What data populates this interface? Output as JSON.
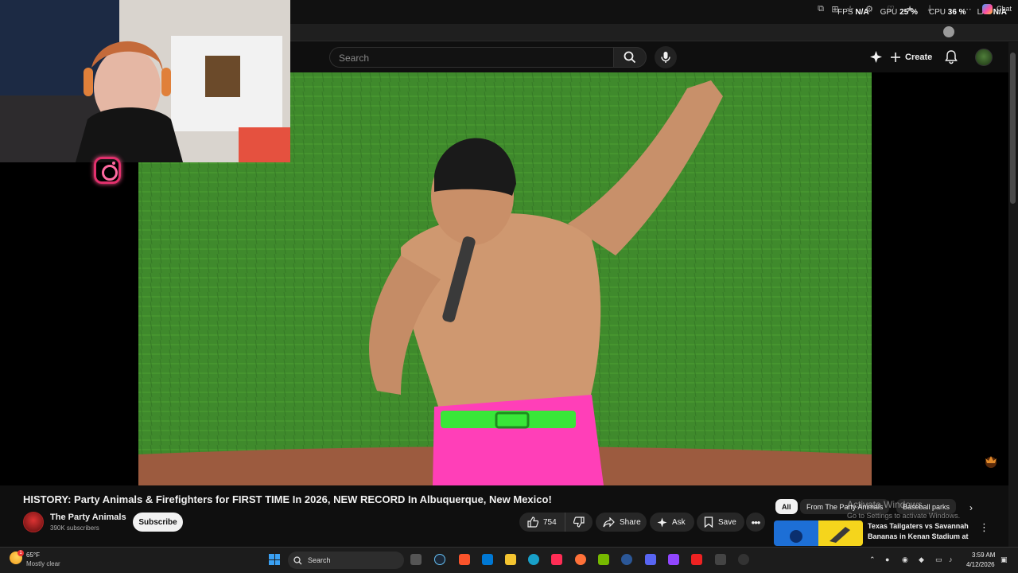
{
  "perf": {
    "fps_label": "FPS",
    "fps_value": "N/A",
    "gpu_label": "GPU",
    "gpu_value": "25 %",
    "cpu_label": "CPU",
    "cpu_value": "36 %",
    "lat_label": "LAT",
    "lat_value": "N/A"
  },
  "browser": {
    "chat_label": "Chat"
  },
  "masthead": {
    "search_placeholder": "Search",
    "create_label": "Create"
  },
  "video": {
    "title": "HISTORY: Party Animals & Firefighters for FIRST TIME In 2026, NEW RECORD In Albuquerque, New Mexico!",
    "channel_name": "The Party Animals",
    "subscribers": "390K subscribers",
    "subscribe_label": "Subscribe",
    "like_count": "754",
    "share_label": "Share",
    "ask_label": "Ask",
    "save_label": "Save"
  },
  "chips": [
    "All",
    "From The Party Animals",
    "Baseball parks"
  ],
  "recommendation": {
    "title": "Texas Tailgaters vs Savannah Bananas in Kenan Stadium at ..."
  },
  "watermark": {
    "line1": "Activate Windows",
    "line2": "Go to Settings to activate Windows."
  },
  "taskbar": {
    "temperature": "65°F",
    "condition": "Mostly clear",
    "weather_badge": "1",
    "search_label": "Search",
    "time": "3:59 AM",
    "date": "4/12/2026"
  },
  "colors": {
    "accent": "#f1f1f1",
    "background": "#0f0f0f",
    "field_green": "#3f8a2c",
    "shorts_pink": "#ff3fb8",
    "belt_green": "#39e639"
  },
  "icons": [
    "search-icon",
    "mic-icon",
    "sparkle-icon",
    "plus-icon",
    "bell-icon",
    "like-icon",
    "dislike-icon",
    "share-icon",
    "ask-icon",
    "save-icon",
    "more-icon",
    "instagram-icon",
    "windows-start-icon",
    "chevron-right-icon"
  ]
}
